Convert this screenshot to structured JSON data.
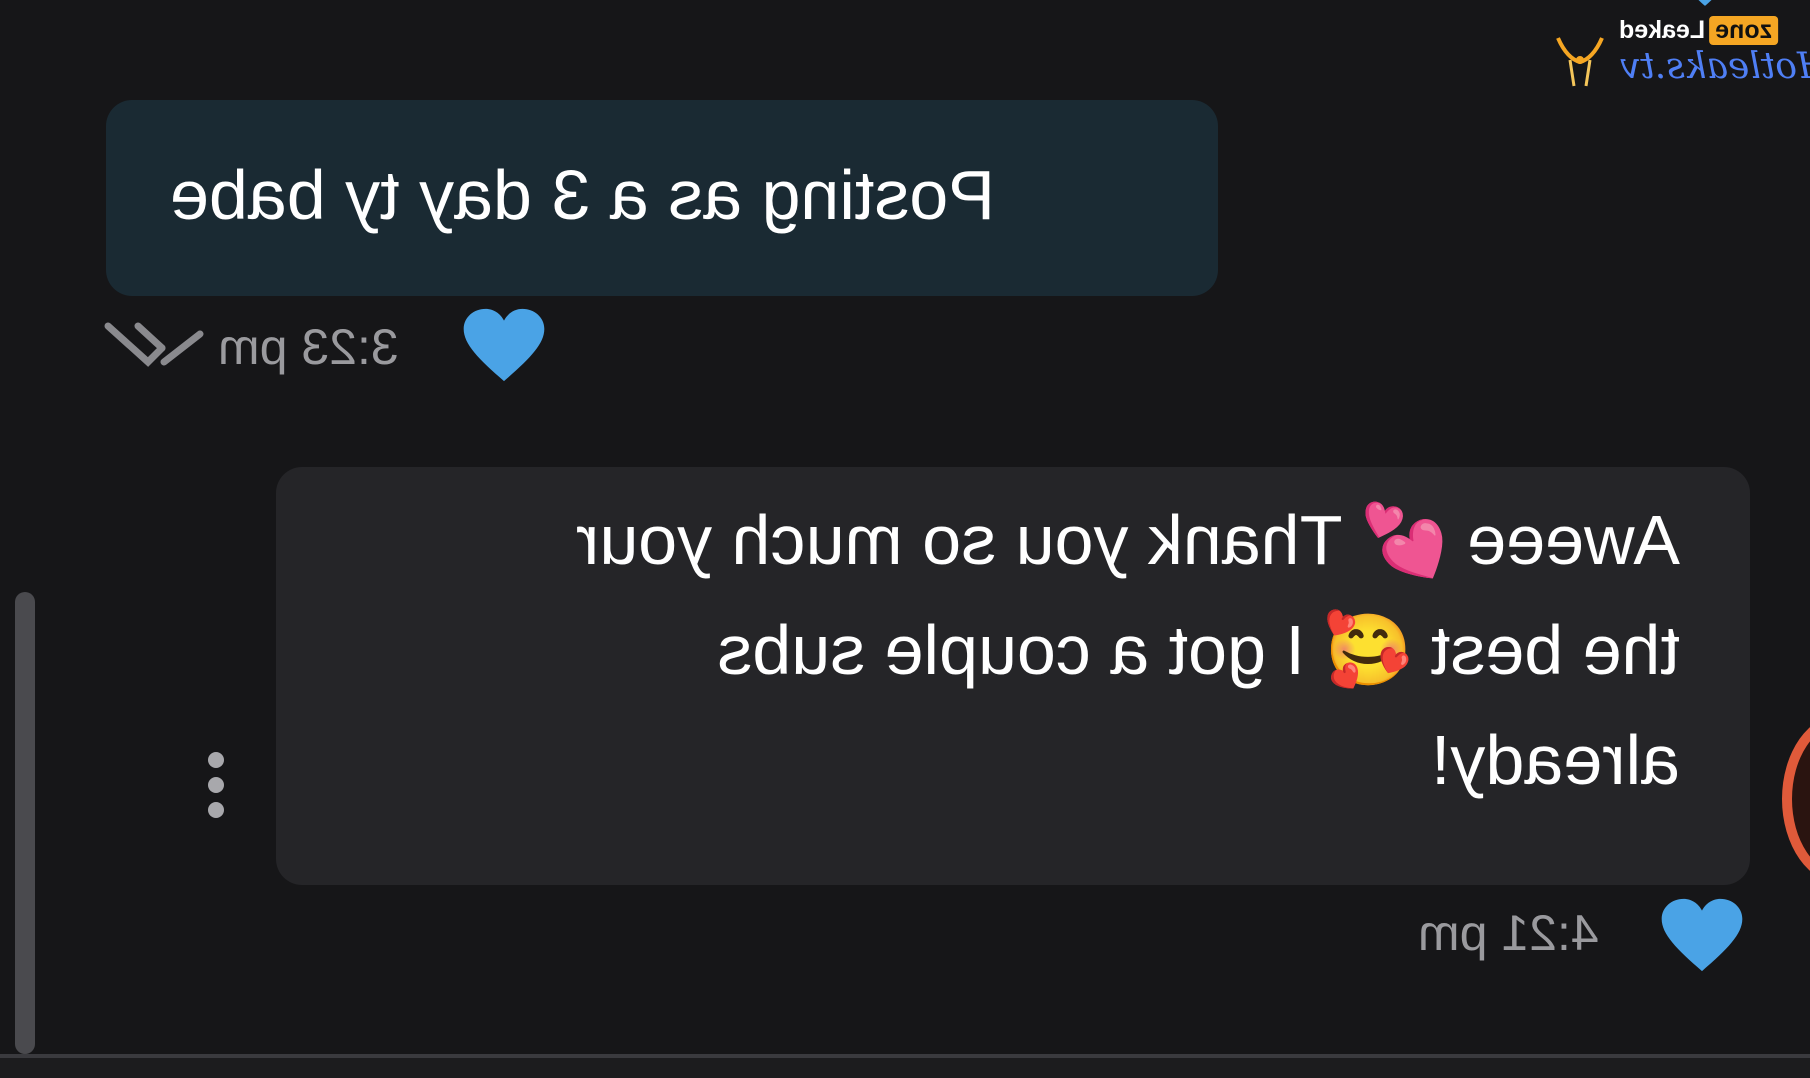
{
  "watermark": {
    "top_left_word": "Leaked",
    "top_right_word": "zone",
    "bottom_word": "Hotleaks.tv"
  },
  "messages": [
    {
      "direction": "outgoing",
      "text": "Posting as a 3 day ty babe",
      "time": "3:23 pm",
      "reaction_icon": "blue-heart-icon"
    },
    {
      "direction": "incoming",
      "lines": [
        "Aweee 💕 Thank you so much your",
        "the best 🥰 I got a couple subs",
        "already!"
      ],
      "time": "4:21 pm",
      "reaction_icon": "blue-heart-icon"
    }
  ],
  "colors": {
    "background": "#161618",
    "outgoing_bubble": "#1a2a33",
    "incoming_bubble": "#252528",
    "heart_blue": "#4aa3e6",
    "meta_text": "#9a9a9e",
    "watermark_orange": "#f5a623",
    "watermark_blue": "#4f7ff5"
  }
}
